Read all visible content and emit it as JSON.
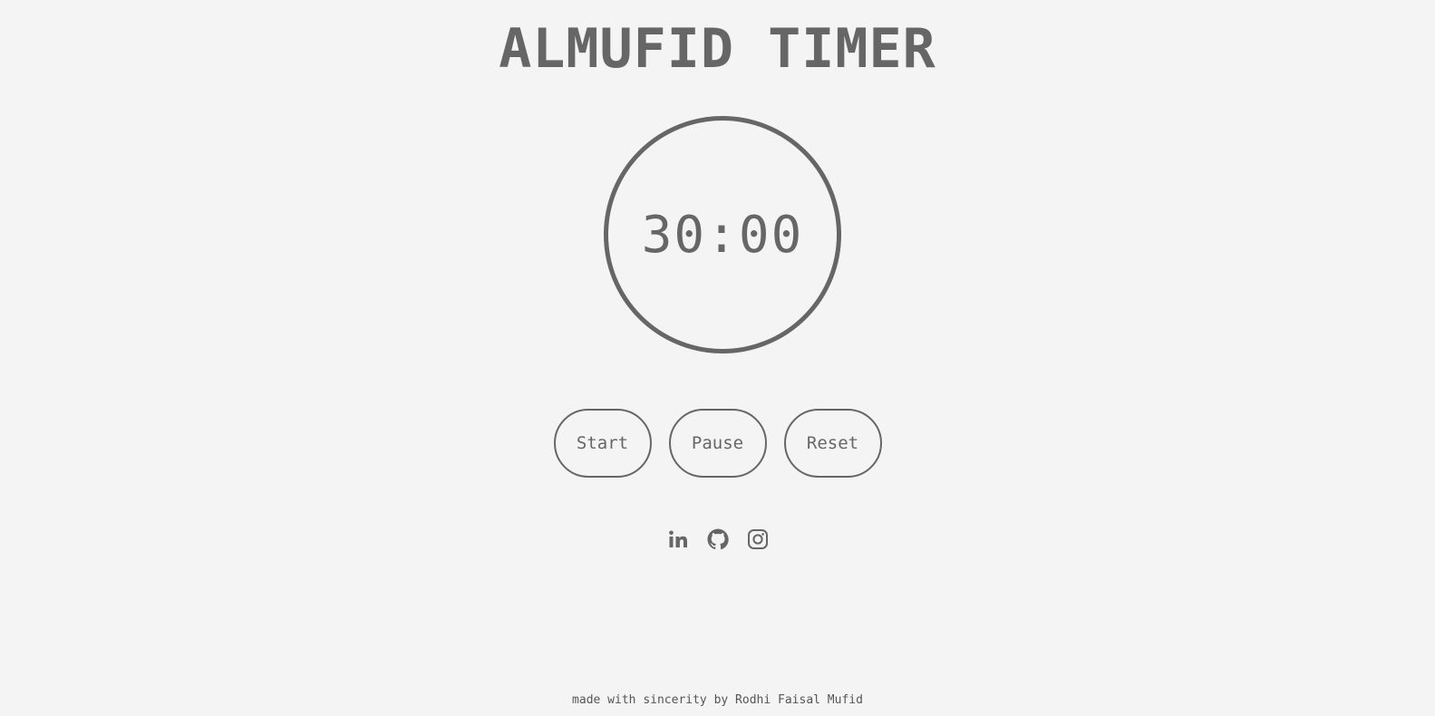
{
  "header": {
    "title": "ALMUFID TIMER"
  },
  "timer": {
    "display": "30:00"
  },
  "controls": {
    "start_label": "Start",
    "pause_label": "Pause",
    "reset_label": "Reset"
  },
  "socials": {
    "icons": [
      "linkedin-icon",
      "github-icon",
      "instagram-icon"
    ]
  },
  "footer": {
    "text": "made with sincerity by Rodhi Faisal Mufid"
  },
  "colors": {
    "background": "#f4f4f4",
    "foreground": "#666666"
  }
}
